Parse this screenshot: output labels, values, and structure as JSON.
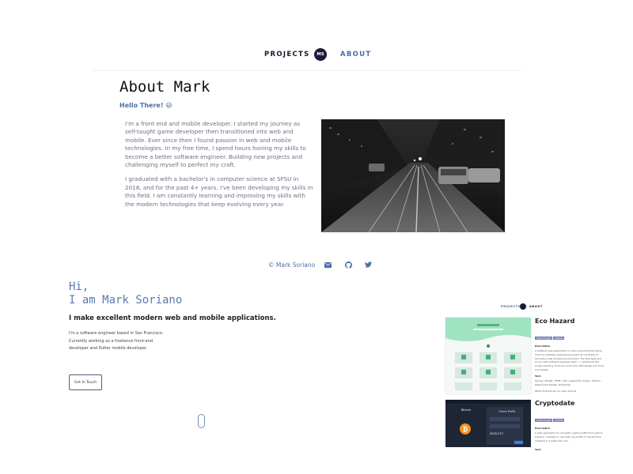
{
  "nav": {
    "projects_label": "PROJECTS",
    "logo_text": "MS",
    "about_label": "ABOUT"
  },
  "about": {
    "title": "About Mark",
    "greeting": "Hello There! 😃",
    "paragraph1": "I'm a front end and mobile developer. I started my journey as self-taught game developer then transitioned into web and mobile. Ever since then I found passion in web and mobile technologies. In my free time, I spend hours honing my skills to become a better software engineer. Building new projects and challenging myself to perfect my craft.",
    "paragraph2": "I graduated with a bachelor's in computer science at SFSU in 2018, and for the past 4+ years, I've been developing my skills in this field. I am constantly learning and improving my skills with the modern technologies that keep evolving every year."
  },
  "footer": {
    "copyright": "© Mark Soriano",
    "icons": [
      "envelope-icon",
      "github-icon",
      "twitter-icon"
    ]
  },
  "hero": {
    "greeting_line1": "Hi,",
    "greeting_line2": "I am Mark Soriano",
    "tagline": "I make excellent modern web and mobile applications.",
    "desc_line1": "I'm a software engineer based in San Francisco.",
    "desc_line2": "Currently working as a freelance front-end",
    "desc_line3": "developer and flutter mobile developer.",
    "cta": "Get In Touch"
  },
  "preview": {
    "nav_projects": "PROJECTS",
    "nav_about": "ABOUT",
    "project1": {
      "title": "Eco Hazard",
      "tags": [
        "View Project",
        "Github"
      ],
      "desc_heading": "Description",
      "desc": "A fullstack web application to solve environmental issue. This is a software engineering project at university to simulate a real working environment. The first agile and scrum with software engineer team — I enhanced the project backing, front-end and more with design and front-end design.",
      "tech_heading": "Tech",
      "tech": "Django, MySQL, HTML, CSS / Javascript, jQuery, Python, Responsive Design, Bootstrap",
      "note": "Other projects are on open source!"
    },
    "project2": {
      "title": "Cryptodate",
      "tags": [
        "View Project",
        "Github"
      ],
      "desc_heading": "Description",
      "desc": "A web application to calculate crypto profits from past to present. I wanted to calculate my profits if I would have invested in a particular coin.",
      "tech_heading": "Tech"
    },
    "crypto_screen": {
      "coin": "Bitcoin",
      "heading": "Check Profit",
      "amount": "$628,233"
    }
  },
  "colors": {
    "accent": "#3d5a9e",
    "logo_bg": "#1a1a3d",
    "text_gray": "#6b7280",
    "link_blue": "#4a6fa5"
  }
}
